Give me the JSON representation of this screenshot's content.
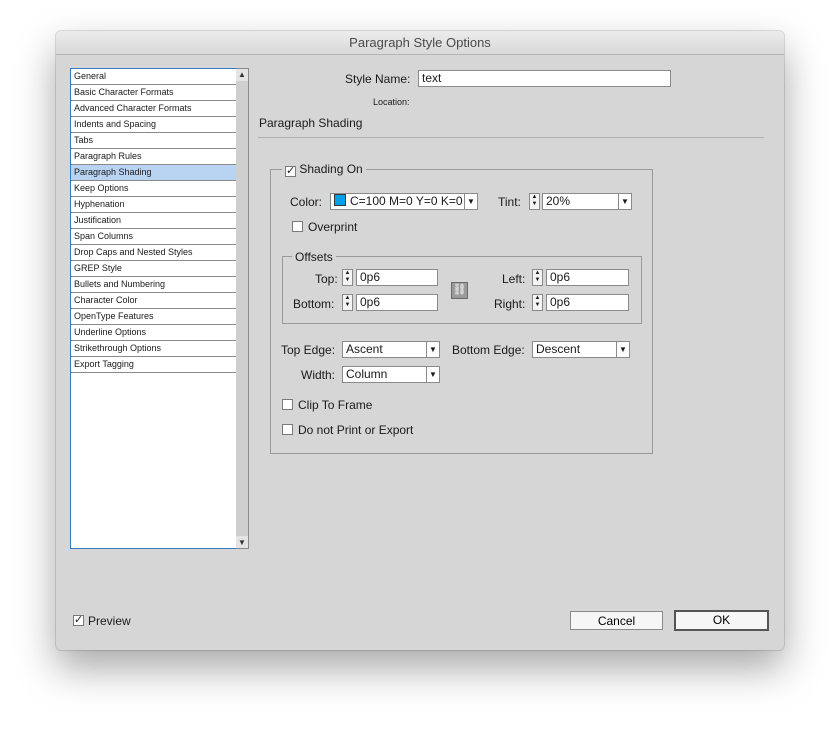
{
  "window": {
    "title": "Paragraph Style Options"
  },
  "sidebar": {
    "items": [
      {
        "label": "General"
      },
      {
        "label": "Basic Character Formats"
      },
      {
        "label": "Advanced Character Formats"
      },
      {
        "label": "Indents and Spacing"
      },
      {
        "label": "Tabs"
      },
      {
        "label": "Paragraph Rules"
      },
      {
        "label": "Paragraph Shading",
        "selected": true
      },
      {
        "label": "Keep Options"
      },
      {
        "label": "Hyphenation"
      },
      {
        "label": "Justification"
      },
      {
        "label": "Span Columns"
      },
      {
        "label": "Drop Caps and Nested Styles"
      },
      {
        "label": "GREP Style"
      },
      {
        "label": "Bullets and Numbering"
      },
      {
        "label": "Character Color"
      },
      {
        "label": "OpenType Features"
      },
      {
        "label": "Underline Options"
      },
      {
        "label": "Strikethrough Options"
      },
      {
        "label": "Export Tagging"
      }
    ]
  },
  "style": {
    "name_label": "Style Name:",
    "name_value": "text",
    "location_label": "Location:"
  },
  "section": {
    "title": "Paragraph Shading"
  },
  "shading": {
    "shading_on_label": "Shading On",
    "shading_on_checked": true,
    "color_label": "Color:",
    "color_value": "C=100 M=0 Y=0 K=0",
    "color_swatch": "#00a0e9",
    "tint_label": "Tint:",
    "tint_value": "20%",
    "overprint_label": "Overprint",
    "overprint_checked": false,
    "offsets": {
      "legend": "Offsets",
      "top_label": "Top:",
      "top_value": "0p6",
      "bottom_label": "Bottom:",
      "bottom_value": "0p6",
      "left_label": "Left:",
      "left_value": "0p6",
      "right_label": "Right:",
      "right_value": "0p6",
      "link_icon": "chain-link-icon"
    },
    "top_edge_label": "Top Edge:",
    "top_edge_value": "Ascent",
    "bottom_edge_label": "Bottom Edge:",
    "bottom_edge_value": "Descent",
    "width_label": "Width:",
    "width_value": "Column",
    "clip_label": "Clip To Frame",
    "clip_checked": false,
    "no_print_label": "Do not Print or Export",
    "no_print_checked": false
  },
  "footer": {
    "preview_label": "Preview",
    "preview_checked": true,
    "cancel_label": "Cancel",
    "ok_label": "OK"
  },
  "glyphs": {
    "check": "✓",
    "dd": "▼",
    "up": "▲",
    "down": "▼"
  }
}
